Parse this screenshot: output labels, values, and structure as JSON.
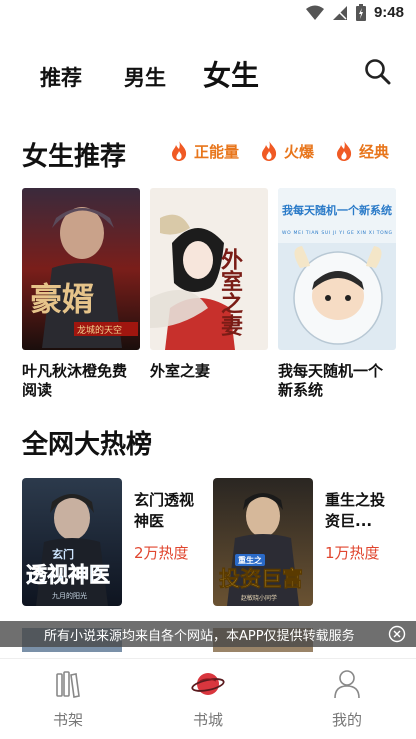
{
  "status_bar": {
    "time": "9:48",
    "icons": [
      "wifi-icon",
      "signal-icon",
      "battery-icon"
    ]
  },
  "top_tabs": [
    {
      "label": "推荐",
      "active": false
    },
    {
      "label": "男生",
      "active": false
    },
    {
      "label": "女生",
      "active": true
    }
  ],
  "search_icon": "search-icon",
  "recommend": {
    "title": "女生推荐",
    "tags": [
      "正能量",
      "火爆",
      "经典"
    ],
    "books": [
      {
        "name": "叶凡秋沐橙免费阅读",
        "cover_text": "豪婿",
        "cover_sub": "龙城的天空"
      },
      {
        "name": "外室之妻",
        "cover_text": "外室之妻",
        "cover_sub": ""
      },
      {
        "name": "我每天随机一个新系统",
        "cover_text": "我每天随机一个新系统",
        "cover_sub": "WO MEI TIAN SUI JI YI GE XIN XI TONG"
      }
    ]
  },
  "hot_list": {
    "title": "全网大热榜",
    "items": [
      {
        "name": "玄门透视神医",
        "heat": "2万热度",
        "cover_text": "透视神医",
        "cover_top": "玄门",
        "cover_sub": "九月的阳光"
      },
      {
        "name": "重生之投资巨...",
        "heat": "1万热度",
        "cover_text": "投资巨富",
        "cover_top": "重生之",
        "cover_sub": "赵敏晓小同学"
      }
    ]
  },
  "notice": {
    "text": "所有小说来源均来自各个网站，本APP仅提供转载服务"
  },
  "bottom_nav": [
    {
      "label": "书架",
      "icon": "bookshelf-icon",
      "active": false
    },
    {
      "label": "书城",
      "icon": "planet-icon",
      "active": true
    },
    {
      "label": "我的",
      "icon": "profile-icon",
      "active": false
    }
  ],
  "colors": {
    "accent_orange": "#e8761c",
    "heat_red": "#e0462f",
    "nav_active": "#d9363e"
  }
}
